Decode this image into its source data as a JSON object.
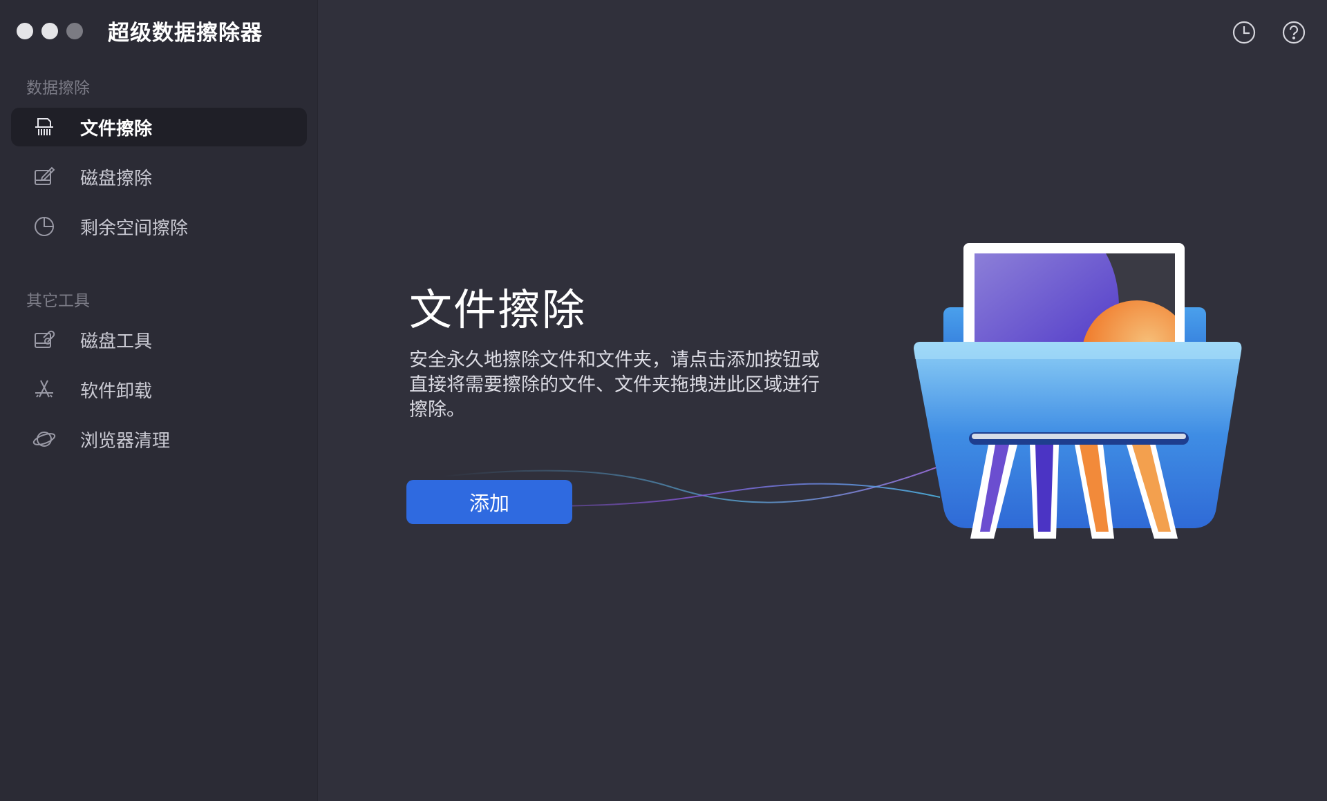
{
  "window": {
    "title": "超级数据擦除器",
    "traffic_lights": [
      "close",
      "minimize",
      "zoom"
    ]
  },
  "header": {
    "history_icon": "clock-icon",
    "help_icon": "question-icon"
  },
  "sidebar": {
    "sections": [
      {
        "title": "数据擦除",
        "items": [
          {
            "label": "文件擦除",
            "icon": "shredder-icon",
            "active": true
          },
          {
            "label": "磁盘擦除",
            "icon": "disk-erase-icon",
            "active": false
          },
          {
            "label": "剩余空间擦除",
            "icon": "pie-chart-icon",
            "active": false
          }
        ]
      },
      {
        "title": "其它工具",
        "items": [
          {
            "label": "磁盘工具",
            "icon": "disk-tool-icon",
            "active": false
          },
          {
            "label": "软件卸载",
            "icon": "app-store-icon",
            "active": false
          },
          {
            "label": "浏览器清理",
            "icon": "planet-icon",
            "active": false
          }
        ]
      }
    ]
  },
  "main": {
    "title": "文件擦除",
    "description": "安全永久地擦除文件和文件夹，请点击添加按钮或直接将需要擦除的文件、文件夹拖拽进此区域进行擦除。",
    "add_button": "添加",
    "illustration": "file-shredder-illustration"
  },
  "colors": {
    "background": "#30303b",
    "sidebar": "#2b2b35",
    "active_item": "#1f1f27",
    "accent": "#2f6ae0"
  }
}
